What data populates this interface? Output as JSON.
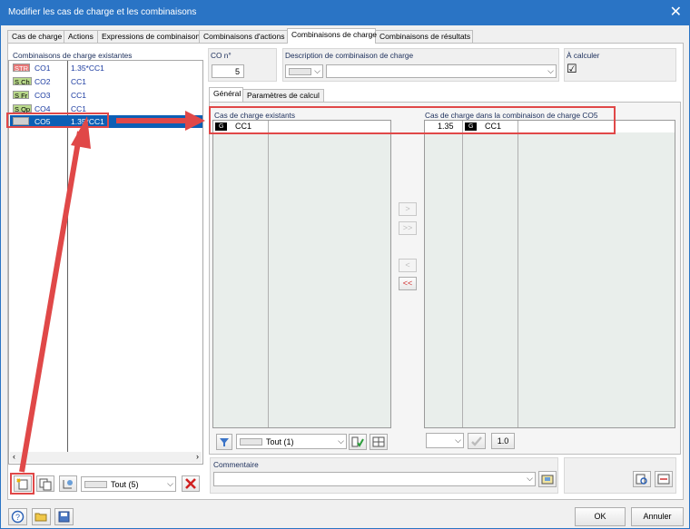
{
  "window": {
    "title": "Modifier les cas de charge et les combinaisons",
    "close": "✕"
  },
  "tabs": [
    "Cas de charge",
    "Actions",
    "Expressions de combinaison",
    "Combinaisons d'actions",
    "Combinaisons de charge",
    "Combinaisons de résultats"
  ],
  "left": {
    "header": "Combinaisons de charge existantes",
    "rows": [
      {
        "badge": "STR",
        "badge_color": "#e87878",
        "name": "CO1",
        "value": "1.35*CC1"
      },
      {
        "badge": "S Ch",
        "badge_color": "#b9d98a",
        "name": "CO2",
        "value": "CC1"
      },
      {
        "badge": "S Fr",
        "badge_color": "#b9d98a",
        "name": "CO3",
        "value": "CC1"
      },
      {
        "badge": "S Qp",
        "badge_color": "#b9d98a",
        "name": "CO4",
        "value": "CC1"
      },
      {
        "badge": "",
        "badge_color": "#cfcfcf",
        "name": "CO5",
        "value": "1.35*CC1"
      }
    ],
    "filter_value": "Tout (5)"
  },
  "co": {
    "label": "CO n°",
    "value": "5"
  },
  "description": {
    "label": "Description de combinaison de charge",
    "value": ""
  },
  "a_calculer": {
    "label": "À calculer",
    "checked": "☑"
  },
  "subtabs": [
    "Général",
    "Paramètres de calcul"
  ],
  "existing": {
    "header": "Cas de charge existants",
    "badge": "G",
    "name": "CC1",
    "filter": "Tout (1)"
  },
  "incombo": {
    "header": "Cas de charge dans la combinaison de charge CO5",
    "factor": "1.35",
    "badge": "G",
    "name": "CC1",
    "factor_button": "1.0"
  },
  "transfer": {
    "add": ">",
    "add_all": ">>",
    "remove": "<",
    "remove_all": "<<"
  },
  "comment": {
    "label": "Commentaire",
    "value": ""
  },
  "buttons": {
    "ok": "OK",
    "cancel": "Annuler"
  },
  "colors": {
    "accent": "#2a74c5",
    "selection": "#0c5fb5",
    "annotation": "#e04848"
  }
}
